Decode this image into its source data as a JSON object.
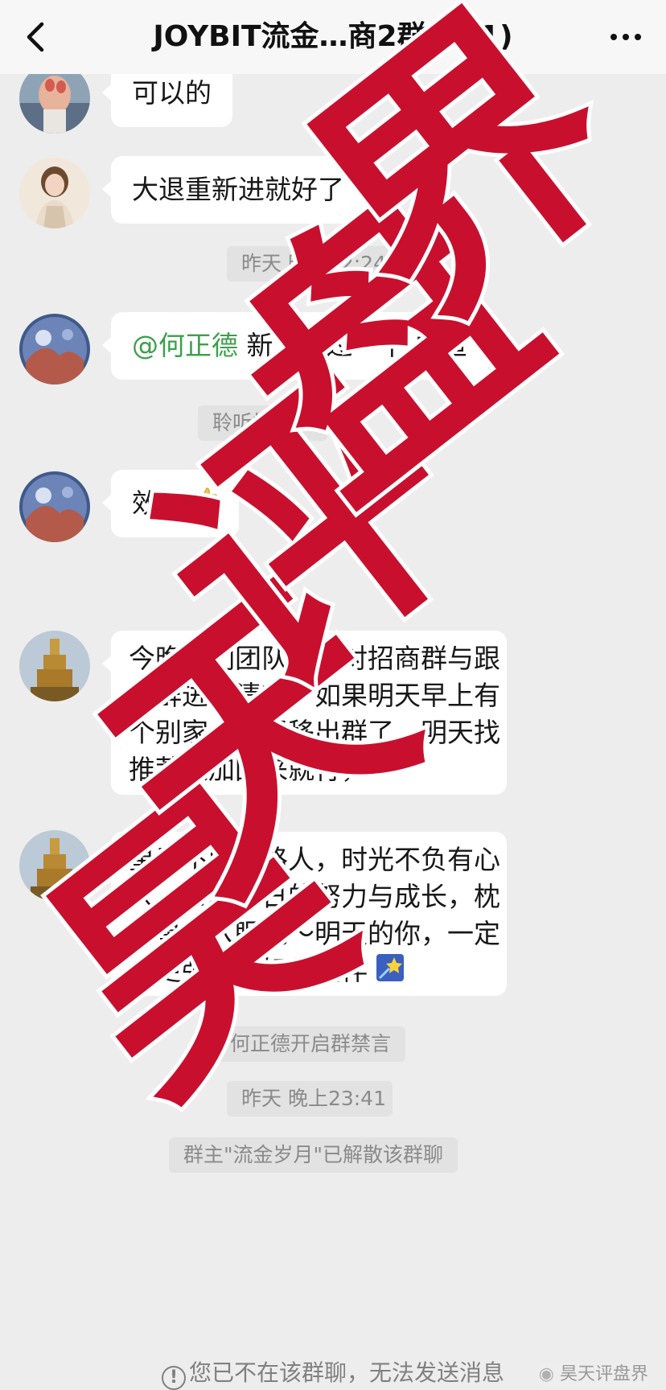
{
  "header": {
    "title": "JOYBIT流金…商2群(171)",
    "back_icon": "chevron-left-icon",
    "more_icon": "more-dots-icon"
  },
  "messages": [
    {
      "type": "text",
      "avatar": "avatar-hands",
      "text": "可以的"
    },
    {
      "type": "text",
      "avatar": "avatar-woman",
      "text": "大退重新进就好了"
    },
    {
      "type": "system",
      "text": "昨天 晚上22:24"
    },
    {
      "type": "text",
      "avatar": "avatar-scene",
      "mention": "@何正德",
      "text": " 新人通过一下 咸鱼"
    },
    {
      "type": "system",
      "text": "聆听把咸鱼"
    },
    {
      "type": "text",
      "avatar": "avatar-scene",
      "text": "效率",
      "emoji": "thumbs-up-emoji"
    },
    {
      "type": "text",
      "avatar": "avatar-temple",
      "lines": [
        "今晚我们团队需要对招商群与跟",
        "单群进行清查，如果明天早上有",
        "个别家人被误移出群了，明天找",
        "推荐人加回来就行，"
      ]
    },
    {
      "type": "text",
      "avatar": "avatar-temple",
      "lines": [
        "星辰不问赶路人，时光不负有心",
        "人。带着今日的努力与成长，枕",
        "着星光入眠吧～明天的你，一定",
        "会更强大！好梦相伴"
      ],
      "emoji": "shooting-star-emoji"
    },
    {
      "type": "system",
      "text": "何正德开启群禁言"
    },
    {
      "type": "system",
      "text": "昨天 晚上23:41"
    },
    {
      "type": "system",
      "text": "群主\"流金岁月\"已解散该群聊"
    }
  ],
  "footer": {
    "text": "您已不在该群聊，无法发送消息",
    "icon": "info-circle-icon",
    "source": "昊天评盘界"
  },
  "watermark": {
    "text": "昊天评盘界",
    "color": "#c8102e"
  }
}
